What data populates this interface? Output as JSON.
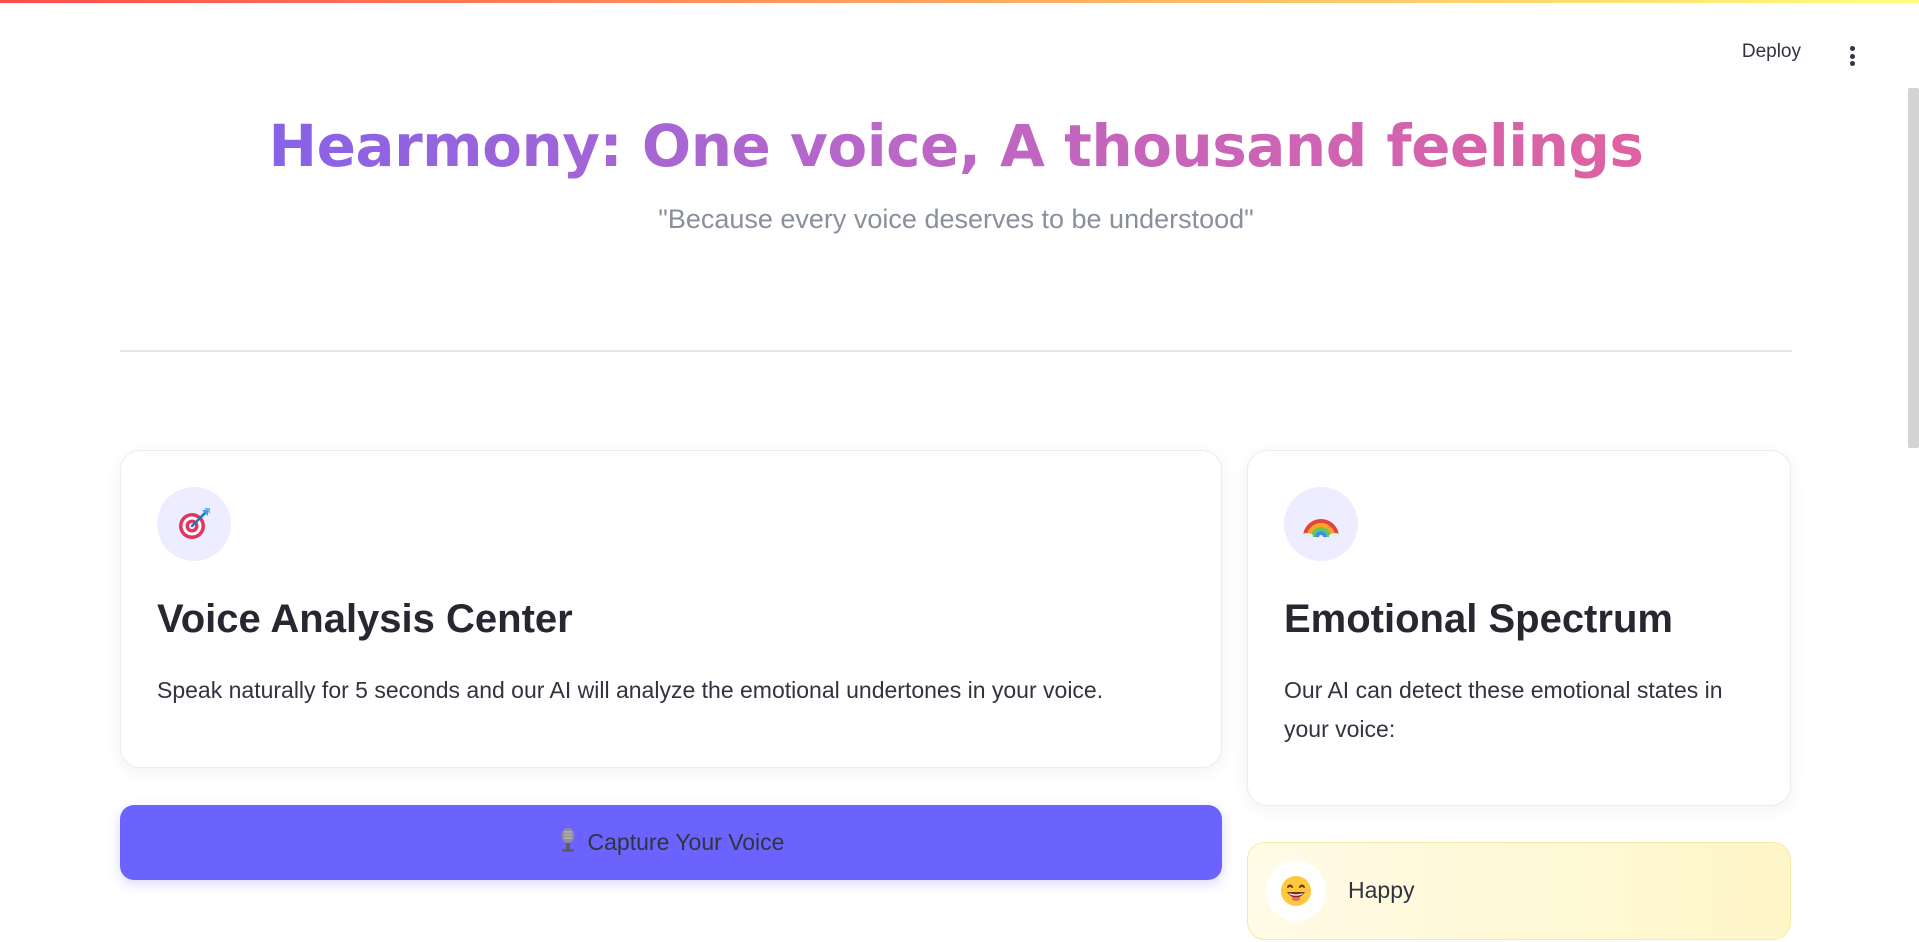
{
  "header": {
    "deploy_label": "Deploy"
  },
  "hero": {
    "title": "Hearmony: One voice, A thousand feelings",
    "subtitle": "\"Because every voice deserves to be understood\""
  },
  "voice_card": {
    "icon": "target-icon",
    "title": "Voice Analysis Center",
    "description": "Speak naturally for 5 seconds and our AI will analyze the emotional undertones in your voice."
  },
  "capture_button": {
    "icon": "microphone-icon",
    "label": "Capture Your Voice"
  },
  "spectrum_card": {
    "icon": "rainbow-icon",
    "title": "Emotional Spectrum",
    "description": "Our AI can detect these emotional states in your voice:"
  },
  "emotions": [
    {
      "icon": "happy-face-icon",
      "label": "Happy"
    }
  ],
  "colors": {
    "accent": "#6c63ff",
    "title_gradient_start": "#7b61f0",
    "title_gradient_end": "#e6609a",
    "icon_circle_bg": "#eeecff",
    "happy_bg": "#fff6c8"
  }
}
